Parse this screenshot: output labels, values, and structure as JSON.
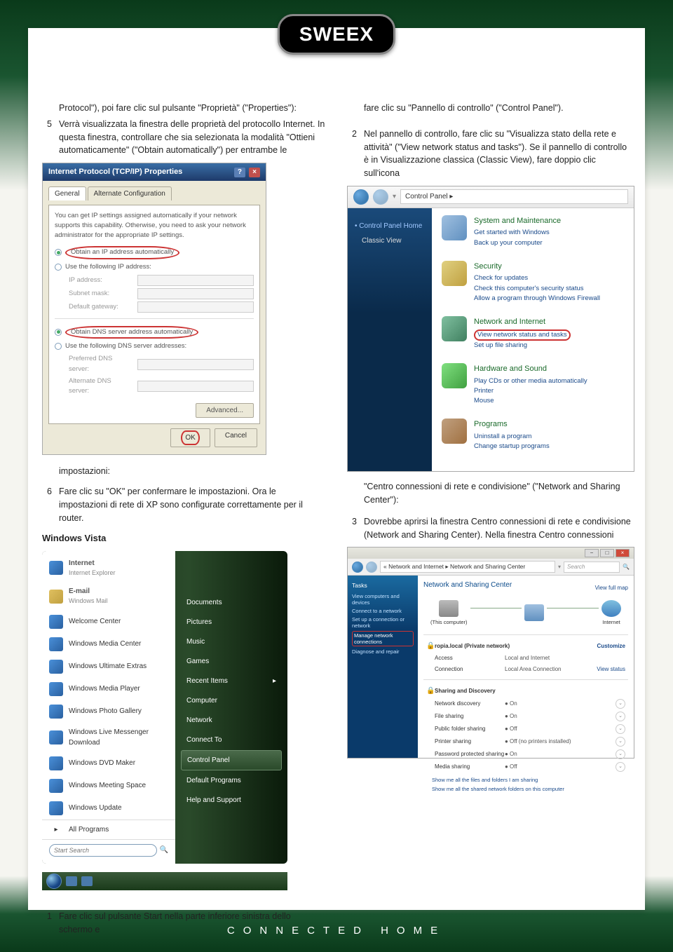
{
  "brand": "SWEEX",
  "footer": "CONNECTED HOME",
  "left": {
    "intro_cont": "Protocol\"), poi fare clic sul pulsante \"Proprietà\" (\"Properties\"):",
    "step5": "Verrà visualizzata la finestra delle proprietà del protocollo Internet. In questa finestra, controllare che sia selezionata la modalità \"Ottieni automaticamente\" (\"Obtain automatically\") per entrambe le",
    "impostazioni": "impostazioni:",
    "step6": "Fare clic su \"OK\" per confermare le impostazioni. Ora le impostazioni di rete di XP sono configurate correttamente per il router.",
    "winvista": "Windows Vista",
    "step1": "Fare clic sul pulsante Start nella parte inferiore sinistra dello schermo e"
  },
  "right": {
    "cont1": "fare clic su \"Pannello di controllo\" (\"Control Panel\").",
    "step2": "Nel pannello di controllo, fare clic su \"Visualizza stato della rete e attività\" (\"View network status and tasks\"). Se il pannello di controllo è in Visualizzazione classica (Classic View), fare doppio clic sull'icona",
    "cont2": "\"Centro connessioni di rete e condivisione\" (\"Network and Sharing Center\"):",
    "step3": "Dovrebbe aprirsi la finestra Centro connessioni di rete e condivisione (Network and Sharing Center). Nella finestra Centro connessioni"
  },
  "xp_dialog": {
    "title": "Internet Protocol (TCP/IP) Properties",
    "tab1": "General",
    "tab2": "Alternate Configuration",
    "desc": "You can get IP settings assigned automatically if your network supports this capability. Otherwise, you need to ask your network administrator for the appropriate IP settings.",
    "r1": "Obtain an IP address automatically",
    "r2": "Use the following IP address:",
    "f1": "IP address:",
    "f2": "Subnet mask:",
    "f3": "Default gateway:",
    "r3": "Obtain DNS server address automatically",
    "r4": "Use the following DNS server addresses:",
    "f4": "Preferred DNS server:",
    "f5": "Alternate DNS server:",
    "adv": "Advanced...",
    "ok": "OK",
    "cancel": "Cancel"
  },
  "vista_start": {
    "internet_main": "Internet",
    "internet_sub": "Internet Explorer",
    "email_main": "E-mail",
    "email_sub": "Windows Mail",
    "items": [
      "Welcome Center",
      "Windows Media Center",
      "Windows Ultimate Extras",
      "Windows Media Player",
      "Windows Photo Gallery",
      "Windows Live Messenger Download",
      "Windows DVD Maker",
      "Windows Meeting Space",
      "Windows Update"
    ],
    "all": "All Programs",
    "search_ph": "Start Search",
    "right_items": [
      "Documents",
      "Pictures",
      "Music",
      "Games",
      "Recent Items",
      "Computer",
      "Network",
      "Connect To",
      "Control Panel",
      "Default Programs",
      "Help and Support"
    ]
  },
  "cp": {
    "breadcrumb": "Control Panel  ▸",
    "side_home": "Control Panel Home",
    "side_classic": "Classic View",
    "cat1_title": "System and Maintenance",
    "cat1_l1": "Get started with Windows",
    "cat1_l2": "Back up your computer",
    "cat2_title": "Security",
    "cat2_l1": "Check for updates",
    "cat2_l2": "Check this computer's security status",
    "cat2_l3": "Allow a program through Windows Firewall",
    "cat3_title": "Network and Internet",
    "cat3_l1": "View network status and tasks",
    "cat3_l2": "Set up file sharing",
    "cat4_title": "Hardware and Sound",
    "cat4_l1": "Play CDs or other media automatically",
    "cat4_l2": "Printer",
    "cat4_l3": "Mouse",
    "cat5_title": "Programs",
    "cat5_l1": "Uninstall a program",
    "cat5_l2": "Change startup programs"
  },
  "nsc": {
    "bc": "« Network and Internet ▸ Network and Sharing Center",
    "search": "Search",
    "side_title": "Tasks",
    "side_items": [
      "View computers and devices",
      "Connect to a network",
      "Set up a connection or network",
      "Manage network connections",
      "Diagnose and repair"
    ],
    "title": "Network and Sharing Center",
    "fullmap": "View full map",
    "node1": "(This computer)",
    "node2": "",
    "node3": "Internet",
    "netname": "ropia.local (Private network)",
    "customize": "Customize",
    "r_access_l": "Access",
    "r_access_v": "Local and Internet",
    "r_conn_l": "Connection",
    "r_conn_v": "Local Area Connection",
    "r_conn_a": "View status",
    "shd_title": "Sharing and Discovery",
    "rows": [
      {
        "l": "Network discovery",
        "v": "● On"
      },
      {
        "l": "File sharing",
        "v": "● On"
      },
      {
        "l": "Public folder sharing",
        "v": "● Off"
      },
      {
        "l": "Printer sharing",
        "v": "● Off (no printers installed)"
      },
      {
        "l": "Password protected sharing",
        "v": "● On"
      },
      {
        "l": "Media sharing",
        "v": "● Off"
      }
    ],
    "foot1": "Show me all the files and folders I am sharing",
    "foot2": "Show me all the shared network folders on this computer"
  }
}
